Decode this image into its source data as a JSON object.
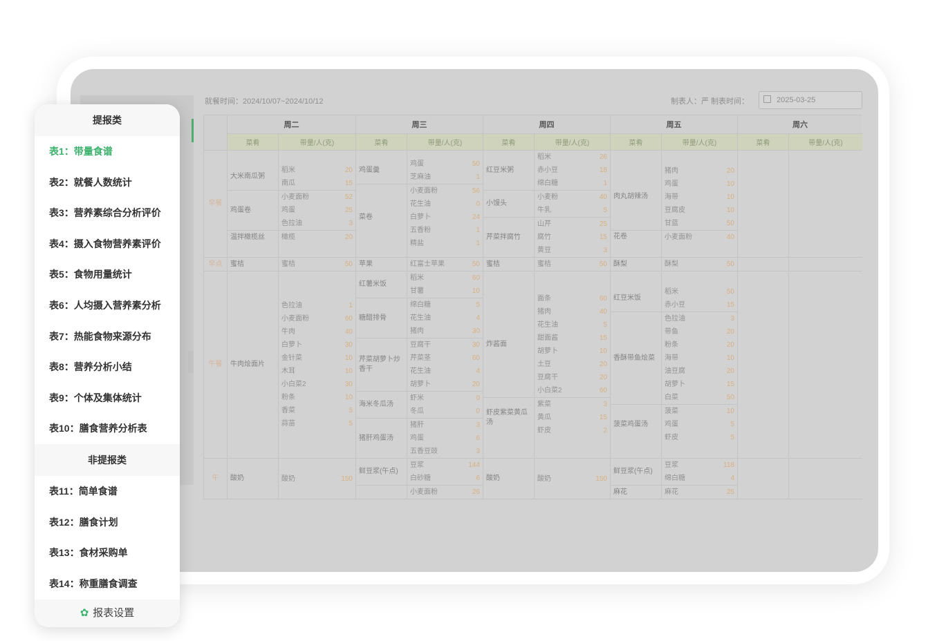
{
  "menu": {
    "section_report": "提报类",
    "items_report": [
      "表1：带量食谱",
      "表2：就餐人数统计",
      "表3：营养素综合分析评价",
      "表4：摄入食物营养素评价",
      "表5：食物用量统计",
      "表6：人均摄入营养素分析",
      "表7：热能食物来源分布",
      "表8：营养分析小结",
      "表9：个体及集体统计",
      "表10：膳食营养分析表"
    ],
    "section_nonreport": "非提报类",
    "items_nonreport": [
      "表11：简单食谱",
      "表12：膳食计划",
      "表13：食材采购单",
      "表14：称重膳食调查"
    ],
    "active_index": 0,
    "settings": "报表设置",
    "accent": "#3bb26b"
  },
  "header": {
    "dining_time": "就餐时间：2024/10/07~2024/10/12",
    "maker": "制表人：严  制表时间：",
    "date": "2025-03-25"
  },
  "table": {
    "days": [
      "周二",
      "周三",
      "周四",
      "周五",
      "周六"
    ],
    "col_dish": "菜肴",
    "col_amount": "带量/人(克)",
    "meals": [
      "早餐",
      "早点",
      "午餐",
      "午"
    ],
    "blocks": [
      {
        "meal": 0,
        "days": [
          [
            {
              "dish": "大米南瓜粥",
              "ings": [
                [
                  "稻米",
                  "20"
                ],
                [
                  "南瓜",
                  "15"
                ]
              ]
            },
            {
              "dish": "鸡蛋卷",
              "ings": [
                [
                  "小麦面粉",
                  "52"
                ],
                [
                  "鸡蛋",
                  "25"
                ],
                [
                  "色拉油",
                  "3"
                ]
              ]
            },
            {
              "dish": "温拌橄榄丝",
              "ings": [
                [
                  "橄榄",
                  "20"
                ]
              ]
            }
          ],
          [
            {
              "dish": "鸡蛋羹",
              "ings": [
                [
                  "鸡蛋",
                  "50"
                ],
                [
                  "芝麻油",
                  "1"
                ]
              ]
            },
            {
              "dish": "菜卷",
              "ings": [
                [
                  "小麦面粉",
                  "56"
                ],
                [
                  "花生油",
                  "0"
                ],
                [
                  "白萝卜",
                  "24"
                ],
                [
                  "五香粉",
                  "1"
                ],
                [
                  "精盐",
                  "1"
                ]
              ]
            }
          ],
          [
            {
              "dish": "红豆米粥",
              "ings": [
                [
                  "稻米",
                  "26"
                ],
                [
                  "赤小豆",
                  "18"
                ],
                [
                  "绵白糖",
                  "1"
                ]
              ]
            },
            {
              "dish": "小馒头",
              "ings": [
                [
                  "小麦粉",
                  "40"
                ],
                [
                  "牛乳",
                  "5"
                ]
              ]
            },
            {
              "dish": "芹菜拌腐竹",
              "ings": [
                [
                  "山芹",
                  "25"
                ],
                [
                  "腐竹",
                  "15"
                ],
                [
                  "黄豆",
                  "3"
                ]
              ]
            }
          ],
          [
            {
              "dish": "肉丸胡辣汤",
              "ings": [
                [
                  "猪肉",
                  "20"
                ],
                [
                  "鸡蛋",
                  "10"
                ],
                [
                  "海带",
                  "10"
                ],
                [
                  "豆腐皮",
                  "10"
                ],
                [
                  "甘蓝",
                  "50"
                ]
              ]
            },
            {
              "dish": "花卷",
              "ings": [
                [
                  "小麦面粉",
                  "40"
                ]
              ]
            }
          ],
          []
        ]
      },
      {
        "meal": 1,
        "days": [
          [
            {
              "dish": "蜜桔",
              "ings": [
                [
                  "蜜桔",
                  "50"
                ]
              ]
            }
          ],
          [
            {
              "dish": "苹果",
              "ings": [
                [
                  "红富士苹果",
                  "50"
                ]
              ]
            }
          ],
          [
            {
              "dish": "蜜桔",
              "ings": [
                [
                  "蜜桔",
                  "50"
                ]
              ]
            }
          ],
          [
            {
              "dish": "酥梨",
              "ings": [
                [
                  "酥梨",
                  "50"
                ]
              ]
            }
          ],
          []
        ]
      },
      {
        "meal": 2,
        "days": [
          [
            {
              "dish": "牛肉烩面片",
              "ings": [
                [
                  "色拉油",
                  "1"
                ],
                [
                  "小麦面粉",
                  "60"
                ],
                [
                  "牛肉",
                  "40"
                ],
                [
                  "白萝卜",
                  "30"
                ],
                [
                  "金针菜",
                  "10"
                ],
                [
                  "木耳",
                  "10"
                ],
                [
                  "小白菜2",
                  "30"
                ],
                [
                  "粉条",
                  "10"
                ],
                [
                  "香菜",
                  "5"
                ],
                [
                  "蒜苗",
                  "5"
                ]
              ]
            }
          ],
          [
            {
              "dish": "红薯米饭",
              "ings": [
                [
                  "稻米",
                  "60"
                ],
                [
                  "甘薯",
                  "10"
                ]
              ]
            },
            {
              "dish": "糖醋排骨",
              "ings": [
                [
                  "绵白糖",
                  "5"
                ],
                [
                  "花生油",
                  "4"
                ],
                [
                  "猪肉",
                  "30"
                ]
              ]
            },
            {
              "dish": "芹菜胡萝卜炒香干",
              "ings": [
                [
                  "豆腐干",
                  "30"
                ],
                [
                  "芹菜茎",
                  "60"
                ],
                [
                  "花生油",
                  "4"
                ],
                [
                  "胡萝卜",
                  "20"
                ]
              ]
            },
            {
              "dish": "海米冬瓜汤",
              "ings": [
                [
                  "虾米",
                  "0"
                ],
                [
                  "冬瓜",
                  "0"
                ]
              ]
            },
            {
              "dish": "猪肝鸡蛋汤",
              "ings": [
                [
                  "猪肝",
                  "3"
                ],
                [
                  "鸡蛋",
                  "6"
                ],
                [
                  "五香豆豉",
                  "3"
                ]
              ]
            }
          ],
          [
            {
              "dish": "炸酱面",
              "ings": [
                [
                  "面条",
                  "60"
                ],
                [
                  "猪肉",
                  "40"
                ],
                [
                  "花生油",
                  "5"
                ],
                [
                  "甜面酱",
                  "15"
                ],
                [
                  "胡萝卜",
                  "10"
                ],
                [
                  "土豆",
                  "20"
                ],
                [
                  "豆腐干",
                  "20"
                ],
                [
                  "小白菜2",
                  "60"
                ]
              ]
            },
            {
              "dish": "虾皮紫菜黄瓜汤",
              "ings": [
                [
                  "紫菜",
                  "3"
                ],
                [
                  "黄瓜",
                  "15"
                ],
                [
                  "虾皮",
                  "2"
                ]
              ]
            }
          ],
          [
            {
              "dish": "红豆米饭",
              "ings": [
                [
                  "稻米",
                  "50"
                ],
                [
                  "赤小豆",
                  "15"
                ]
              ]
            },
            {
              "dish": "香酥带鱼烩菜",
              "ings": [
                [
                  "色拉油",
                  "3"
                ],
                [
                  "带鱼",
                  "20"
                ],
                [
                  "粉条",
                  "20"
                ],
                [
                  "海带",
                  "10"
                ],
                [
                  "油豆腐",
                  "20"
                ],
                [
                  "胡萝卜",
                  "15"
                ],
                [
                  "白菜",
                  "50"
                ]
              ]
            },
            {
              "dish": "菠菜鸡蛋汤",
              "ings": [
                [
                  "菠菜",
                  "10"
                ],
                [
                  "鸡蛋",
                  "5"
                ],
                [
                  "虾皮",
                  "5"
                ]
              ]
            }
          ],
          []
        ]
      },
      {
        "meal": 3,
        "days": [
          [
            {
              "dish": "酸奶",
              "ings": [
                [
                  "酸奶",
                  "150"
                ]
              ]
            }
          ],
          [
            {
              "dish": "鲜豆浆(午点)",
              "ings": [
                [
                  "豆浆",
                  "144"
                ],
                [
                  "白砂糖",
                  "6"
                ]
              ]
            },
            {
              "dish": "",
              "ings": [
                [
                  "小麦面粉",
                  "26"
                ]
              ]
            }
          ],
          [
            {
              "dish": "酸奶",
              "ings": [
                [
                  "酸奶",
                  "150"
                ]
              ]
            }
          ],
          [
            {
              "dish": "鲜豆浆(午点)",
              "ings": [
                [
                  "豆浆",
                  "118"
                ],
                [
                  "绵白糖",
                  "4"
                ]
              ]
            },
            {
              "dish": "麻花",
              "ings": [
                [
                  "麻花",
                  "25"
                ]
              ]
            }
          ],
          []
        ]
      }
    ]
  }
}
